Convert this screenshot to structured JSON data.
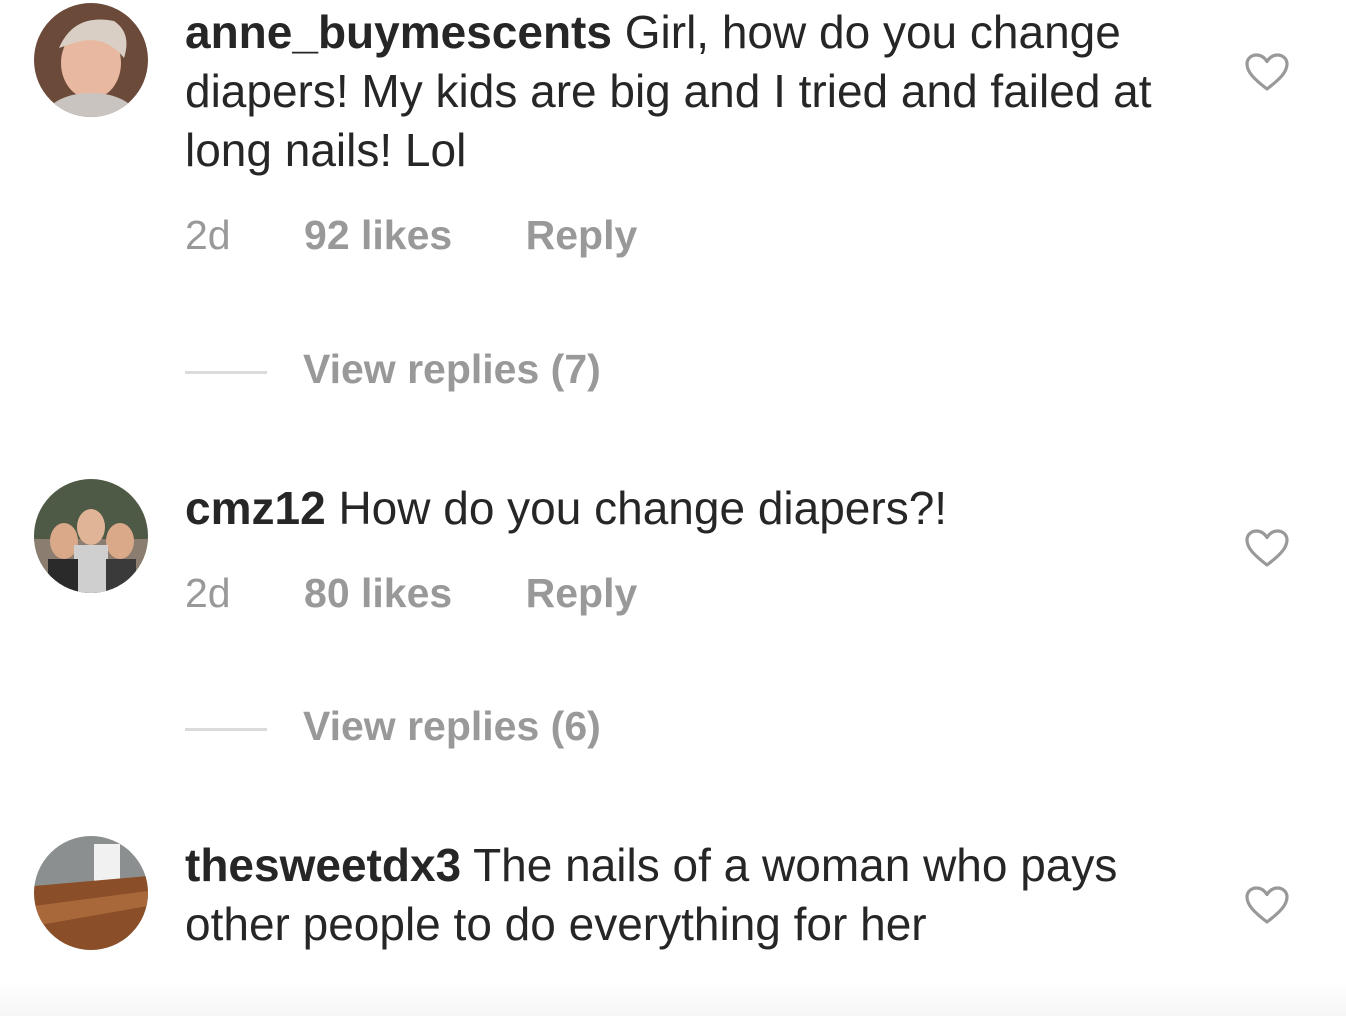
{
  "comments": [
    {
      "username": "anne_buymescents",
      "text": "Girl, how do you change diapers!  My kids are big and I tried and failed at long nails!  Lol",
      "time": "2d",
      "likes": "92 likes",
      "reply": "Reply",
      "view_replies": "View replies (7)",
      "avatar_icon": "avatar-photo",
      "like_icon": "heart-outline-icon"
    },
    {
      "username": "cmz12",
      "text": "How do you change diapers?!",
      "time": "2d",
      "likes": "80 likes",
      "reply": "Reply",
      "view_replies": "View replies (6)",
      "avatar_icon": "avatar-photo",
      "like_icon": "heart-outline-icon"
    },
    {
      "username": "thesweetdx3",
      "text": "The nails of a woman who pays other people to do everything for her",
      "avatar_icon": "avatar-photo",
      "like_icon": "heart-outline-icon"
    }
  ],
  "colors": {
    "text": "#262626",
    "meta": "#999999",
    "divider": "#dbdbdb"
  }
}
